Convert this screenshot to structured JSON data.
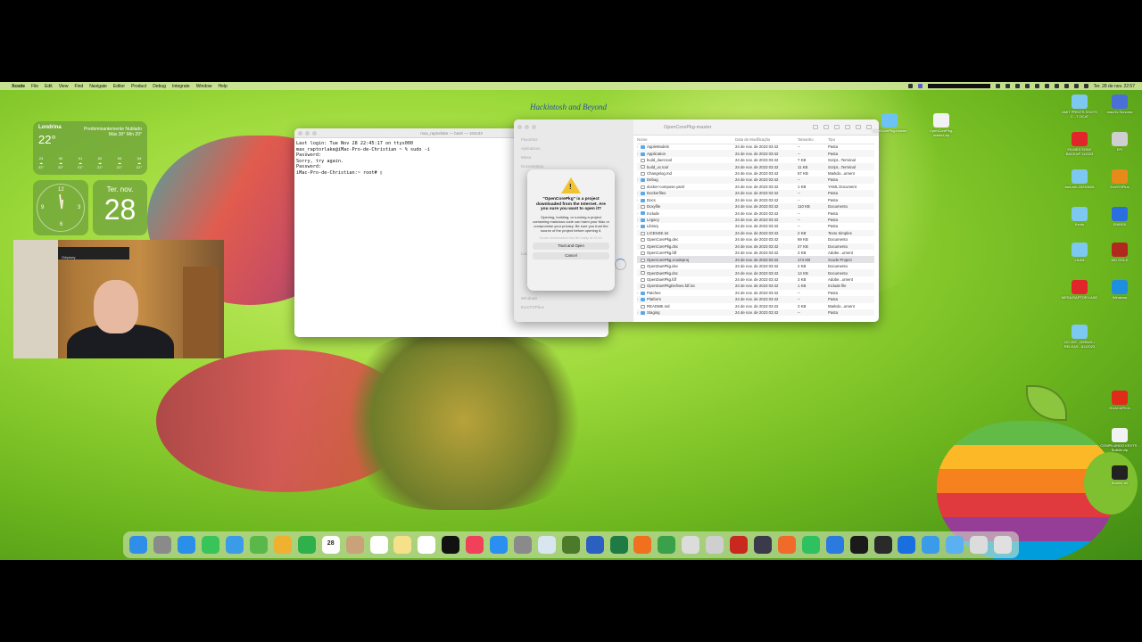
{
  "menubar": {
    "apple": "",
    "items": [
      "Xcode",
      "File",
      "Edit",
      "View",
      "Find",
      "Navigate",
      "Editor",
      "Product",
      "Debug",
      "Integrate",
      "Window",
      "Help"
    ],
    "clock": "Ter. 28 de nov.  22:57"
  },
  "widgets": {
    "weather": {
      "city": "Londrina",
      "temp": "22°",
      "condition": "Predominantemente Nublado",
      "range": "Máx 30° Mín 20°",
      "hours": [
        {
          "h": "23",
          "t": "22°"
        },
        {
          "h": "00",
          "t": "22°"
        },
        {
          "h": "01",
          "t": "21°"
        },
        {
          "h": "02",
          "t": "21°"
        },
        {
          "h": "03",
          "t": "21°"
        },
        {
          "h": "04",
          "t": "21°"
        }
      ]
    },
    "clock": {
      "n12": "12",
      "n3": "3",
      "n6": "6",
      "n9": "9"
    },
    "calendar": {
      "dow": "Ter. nov.",
      "day": "28"
    }
  },
  "webcam": {
    "tv_label": "Odyssey"
  },
  "hackintosh_text": "Hackintosh and Beyond",
  "terminal": {
    "title": "max_raptorlake — bash — 104x33",
    "text": "Last login: Tue Nov 28 22:45:17 on ttys000\nmax_raptorlake@iMac-Pro-de-Christian ~ % sudo -i\nPassword:\nSorry, try again.\nPassword:\niMac-Pro-de-Christian:~ root# ▯"
  },
  "finder": {
    "title": "OpenCorePkg-master",
    "sidebar": [
      "Favoritos",
      "Aplicativos",
      "Mesa",
      "Documentos",
      "Locais",
      "Windows",
      "EuroTOPbus"
    ],
    "columns": {
      "name": "Nome",
      "date": "Data de Modificação",
      "size": "Tamanho",
      "kind": "Tipo"
    },
    "rows": [
      {
        "name": "AppleModels",
        "date": "24 de nov. de 2023 03:42",
        "size": "--",
        "kind": "Pasta",
        "folder": true
      },
      {
        "name": "Application",
        "date": "24 de nov. de 2023 03:42",
        "size": "--",
        "kind": "Pasta",
        "folder": true
      },
      {
        "name": "build_duet.tool",
        "date": "24 de nov. de 2023 03:42",
        "size": "7 KB",
        "kind": "Script...Terminal",
        "folder": false
      },
      {
        "name": "build_oc.tool",
        "date": "24 de nov. de 2023 03:42",
        "size": "11 KB",
        "kind": "Script...Terminal",
        "folder": false
      },
      {
        "name": "Changelog.md",
        "date": "24 de nov. de 2023 03:42",
        "size": "57 KB",
        "kind": "Markdo...ument",
        "folder": false
      },
      {
        "name": "Debug",
        "date": "24 de nov. de 2023 03:42",
        "size": "--",
        "kind": "Pasta",
        "folder": true
      },
      {
        "name": "docker-compose.yaml",
        "date": "24 de nov. de 2023 03:42",
        "size": "1 KB",
        "kind": "YAML Document",
        "folder": false
      },
      {
        "name": "Dockerfiles",
        "date": "24 de nov. de 2023 03:42",
        "size": "--",
        "kind": "Pasta",
        "folder": true
      },
      {
        "name": "Docs",
        "date": "24 de nov. de 2023 03:42",
        "size": "--",
        "kind": "Pasta",
        "folder": true
      },
      {
        "name": "Doxyfile",
        "date": "24 de nov. de 2023 03:42",
        "size": "110 KB",
        "kind": "Documento",
        "folder": false
      },
      {
        "name": "Include",
        "date": "24 de nov. de 2023 03:42",
        "size": "--",
        "kind": "Pasta",
        "folder": true
      },
      {
        "name": "Legacy",
        "date": "24 de nov. de 2023 03:42",
        "size": "--",
        "kind": "Pasta",
        "folder": true
      },
      {
        "name": "Library",
        "date": "24 de nov. de 2023 03:42",
        "size": "--",
        "kind": "Pasta",
        "folder": true
      },
      {
        "name": "LICENSE.txt",
        "date": "24 de nov. de 2023 03:42",
        "size": "2 KB",
        "kind": "Texto Simples",
        "folder": false
      },
      {
        "name": "OpenCorePkg.dec",
        "date": "24 de nov. de 2023 03:42",
        "size": "69 KB",
        "kind": "Documento",
        "folder": false
      },
      {
        "name": "OpenCorePkg.dsc",
        "date": "24 de nov. de 2023 03:42",
        "size": "27 KB",
        "kind": "Documento",
        "folder": false
      },
      {
        "name": "OpenCorePkg.fdf",
        "date": "24 de nov. de 2023 03:42",
        "size": "3 KB",
        "kind": "Adobe...ument",
        "folder": false
      },
      {
        "name": "OpenCorePkg.xcodeproj",
        "date": "24 de nov. de 2023 03:42",
        "size": "174 KB",
        "kind": "Xcode Project",
        "folder": false,
        "selected": true
      },
      {
        "name": "OpenDuetPkg.dec",
        "date": "24 de nov. de 2023 03:42",
        "size": "2 KB",
        "kind": "Documento",
        "folder": false
      },
      {
        "name": "OpenDuetPkg.dsc",
        "date": "24 de nov. de 2023 03:42",
        "size": "14 KB",
        "kind": "Documento",
        "folder": false
      },
      {
        "name": "OpenDuetPkg.fdf",
        "date": "24 de nov. de 2023 03:42",
        "size": "3 KB",
        "kind": "Adobe...ument",
        "folder": false
      },
      {
        "name": "OpenDuetPkgDefines.fdf.inc",
        "date": "24 de nov. de 2023 03:42",
        "size": "1 KB",
        "kind": "Include file",
        "folder": false
      },
      {
        "name": "Patches",
        "date": "24 de nov. de 2023 03:42",
        "size": "--",
        "kind": "Pasta",
        "folder": true
      },
      {
        "name": "Platform",
        "date": "24 de nov. de 2023 03:42",
        "size": "--",
        "kind": "Pasta",
        "folder": true
      },
      {
        "name": "README.md",
        "date": "24 de nov. de 2023 03:42",
        "size": "3 KB",
        "kind": "Markdo...ument",
        "folder": false
      },
      {
        "name": "Staging",
        "date": "24 de nov. de 2023 03:42",
        "size": "--",
        "kind": "Pasta",
        "folder": true
      }
    ]
  },
  "dialog": {
    "headline": "\"OpenCorePkg\" is a project downloaded from the Internet. Are you sure you want to open it?",
    "body": "Opening, building, or running a project containing malicious code can harm your Mac or compromise your privacy. Be sure you trust the source of the project before opening it.",
    "faint": "Xcode downloaded this file today at 22:44.",
    "trust_label": "Trust and Open",
    "cancel_label": "Cancel"
  },
  "desktop_icons": [
    {
      "label": "AMIT PRINTS SSDTS C...T OCAT",
      "color": "#7cc8f0"
    },
    {
      "label": "macOs Sonoma",
      "color": "#4a6fd6"
    },
    {
      "label": "OpenCorePkg-master",
      "color": "#6cc2f2"
    },
    {
      "label": "OpenCorePkg-master.zip",
      "color": "#f2f2f2"
    },
    {
      "label": "FILMES SONY BACKUP 112023",
      "color": "#e0262a"
    },
    {
      "label": "EFI",
      "color": "#cfcfcf"
    },
    {
      "label": "last-win-20230626",
      "color": "#7cc8f0"
    },
    {
      "label": "Evo970Plus",
      "color": "#e88a1a"
    },
    {
      "label": "Kexts",
      "color": "#7cc8f0"
    },
    {
      "label": "SN850X",
      "color": "#2a6fe0"
    },
    {
      "label": "LiluKit",
      "color": "#7cc8f0"
    },
    {
      "label": "WD GOLD",
      "color": "#b0281e"
    },
    {
      "label": "MESA RAPTOR LAKE",
      "color": "#e0262a"
    },
    {
      "label": "Windows",
      "color": "#1e8fe0"
    },
    {
      "label": "OC 097 - DEBUG / RELEAS...8112023",
      "color": "#7cc8f0"
    },
    {
      "label": "GUACAPICA",
      "color": "#e02a1a"
    },
    {
      "label": "COMPILANDO KEXTS - Buildin.zip",
      "color": "#f2f2f2"
    },
    {
      "label": "Buildin' All",
      "color": "#222222"
    }
  ],
  "dock": [
    {
      "name": "finder",
      "color": "#2f8ee8"
    },
    {
      "name": "launchpad",
      "color": "#8a8a8a"
    },
    {
      "name": "safari",
      "color": "#2a8fe8"
    },
    {
      "name": "messages",
      "color": "#39c45a"
    },
    {
      "name": "mail",
      "color": "#3a9be8"
    },
    {
      "name": "maps",
      "color": "#5ab84a"
    },
    {
      "name": "photos",
      "color": "#f0b030"
    },
    {
      "name": "facetime",
      "color": "#2fb04a"
    },
    {
      "name": "calendar",
      "color": "#ffffff",
      "text": "28"
    },
    {
      "name": "contacts",
      "color": "#c9a27a"
    },
    {
      "name": "reminders",
      "color": "#ffffff"
    },
    {
      "name": "notes",
      "color": "#f6e08a"
    },
    {
      "name": "freeform",
      "color": "#ffffff"
    },
    {
      "name": "apple-tv",
      "color": "#111111"
    },
    {
      "name": "music",
      "color": "#f0405a"
    },
    {
      "name": "app-store",
      "color": "#2a8ff0"
    },
    {
      "name": "system-settings",
      "color": "#8a8a8a"
    },
    {
      "name": "preview",
      "color": "#d8e6f0"
    },
    {
      "name": "keyboard-tool",
      "color": "#4a7a2a"
    },
    {
      "name": "word",
      "color": "#2b5fc0"
    },
    {
      "name": "excel",
      "color": "#1f7a44"
    },
    {
      "name": "firefox",
      "color": "#f07020"
    },
    {
      "name": "activity-monitor",
      "color": "#3aa04a"
    },
    {
      "name": "disk-utility",
      "color": "#dcdcdc"
    },
    {
      "name": "script-tool",
      "color": "#cfcfcf"
    },
    {
      "name": "red-app",
      "color": "#c8281e"
    },
    {
      "name": "utility-app",
      "color": "#3a3a4a"
    },
    {
      "name": "orange-app",
      "color": "#f06a2a"
    },
    {
      "name": "whatsapp",
      "color": "#2fc060"
    },
    {
      "name": "xcode",
      "color": "#2a7ae0"
    },
    {
      "name": "terminal",
      "color": "#1a1a1a"
    },
    {
      "name": "quicktime",
      "color": "#2a2a2a"
    },
    {
      "name": "video-app",
      "color": "#1a6fe0"
    },
    {
      "name": "xcode-blue",
      "color": "#3a9be8"
    },
    {
      "name": "downloads-folder",
      "color": "#5ab0f0"
    },
    {
      "name": "os-app",
      "color": "#dcdcdc"
    },
    {
      "name": "trash",
      "color": "#e0e0e0"
    }
  ]
}
